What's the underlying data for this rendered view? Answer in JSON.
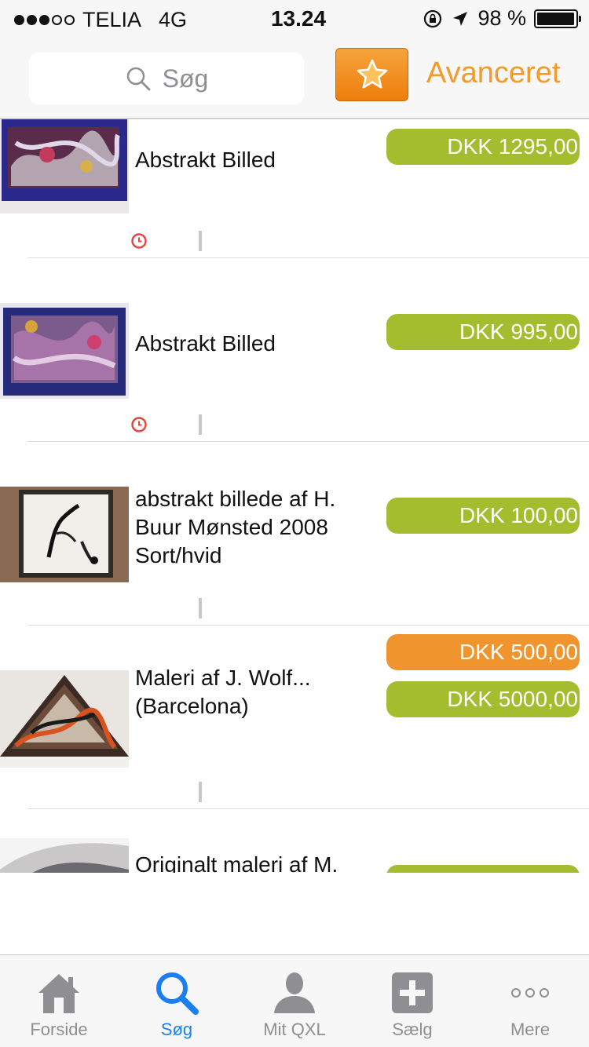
{
  "status_bar": {
    "carrier": "TELIA",
    "network": "4G",
    "time": "13.24",
    "battery_text": "98 %",
    "battery_level": 0.98
  },
  "header": {
    "search_placeholder": "Søg",
    "favorite_icon": "star-icon",
    "advanced_label": "Avanceret",
    "accent_color": "#f39a2a"
  },
  "listings": [
    {
      "title": "Abstrakt Billed",
      "prices": [
        {
          "text": "DKK 1295,00",
          "color": "green"
        }
      ],
      "has_timer": true
    },
    {
      "title": "Abstrakt Billed",
      "prices": [
        {
          "text": "DKK 995,00",
          "color": "green"
        }
      ],
      "has_timer": true
    },
    {
      "title": "abstrakt billede af H. Buur Mønsted 2008 Sort/hvid",
      "prices": [
        {
          "text": "DKK 100,00",
          "color": "green"
        }
      ],
      "has_timer": false
    },
    {
      "title": "Maleri af J. Wolf... (Barcelona)",
      "prices": [
        {
          "text": "DKK 500,00",
          "color": "orange"
        },
        {
          "text": "DKK 5000,00",
          "color": "green"
        }
      ],
      "has_timer": false
    },
    {
      "title": "Originalt maleri af M.",
      "prices": [
        {
          "text": "",
          "color": "green"
        }
      ],
      "has_timer": false
    }
  ],
  "tabs": [
    {
      "label": "Forside",
      "icon": "house-icon",
      "active": false
    },
    {
      "label": "Søg",
      "icon": "search-icon",
      "active": true
    },
    {
      "label": "Mit QXL",
      "icon": "user-icon",
      "active": false
    },
    {
      "label": "Sælg",
      "icon": "plus-icon",
      "active": false
    },
    {
      "label": "Mere",
      "icon": "more-icon",
      "active": false
    }
  ],
  "colors": {
    "price_green": "#a3bd2f",
    "price_orange": "#f0952e",
    "tab_active": "#1c7ff0",
    "tab_inactive": "#8e8e93"
  }
}
